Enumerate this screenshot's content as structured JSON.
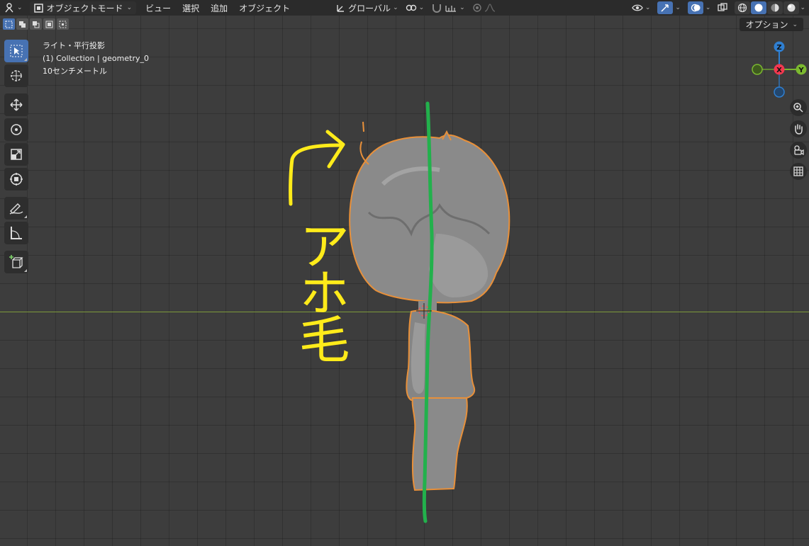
{
  "header": {
    "mode": "オブジェクトモード",
    "menus": [
      "ビュー",
      "選択",
      "追加",
      "オブジェクト"
    ],
    "transform_orientation": "グローバル"
  },
  "options_label": "オプション",
  "viewport_info": {
    "view_name": "ライト・平行投影",
    "collection": "(1) Collection | geometry_0",
    "scale": "10センチメートル"
  },
  "gizmo": {
    "z_label": "Z",
    "x_label": "X",
    "y_label": "Y",
    "colors": {
      "x": "#f2384f",
      "y": "#7bb82f",
      "z": "#2f7fd1"
    }
  },
  "annotation": {
    "text": "アホ毛",
    "color": "#ffeb1a",
    "center_line_color": "#22b14c"
  },
  "toolbar_tools": [
    "select-box",
    "cursor",
    "move",
    "rotate",
    "scale",
    "transform",
    "annotate",
    "measure",
    "add-cube"
  ],
  "colors": {
    "accent": "#4772b3",
    "selection_outline": "#e8903a"
  }
}
